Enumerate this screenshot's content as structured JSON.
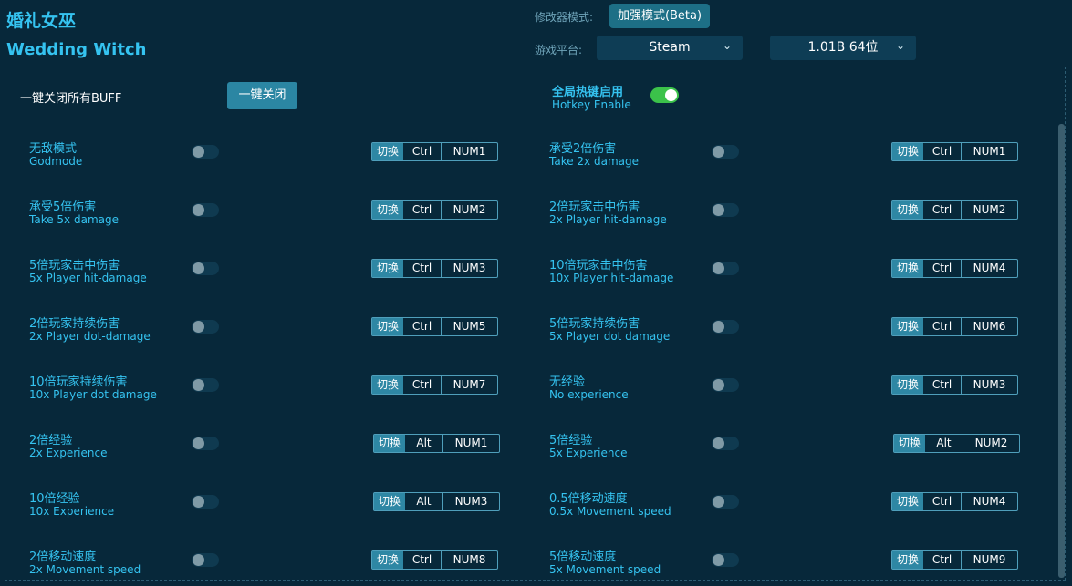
{
  "app": {
    "title_cn": "婚礼女巫",
    "title_en": "Wedding Witch"
  },
  "header": {
    "mode_label": "修改器模式:",
    "mode_button": "加强模式(Beta)",
    "platform_label": "游戏平台:",
    "platform_value": "Steam",
    "version_value": "1.01B 64位"
  },
  "controls": {
    "close_all_label": "一键关闭所有BUFF",
    "close_all_button": "一键关闭",
    "hotkey_cn": "全局热键启用",
    "hotkey_en": "Hotkey Enable",
    "hotkey_enabled": true
  },
  "cheats": [
    {
      "cn": "无敌模式",
      "en": "Godmode",
      "k1": "切换",
      "k2": "Ctrl",
      "k3": "NUM1"
    },
    {
      "cn": "承受2倍伤害",
      "en": "Take 2x damage",
      "k1": "切换",
      "k2": "Ctrl",
      "k3": "NUM1"
    },
    {
      "cn": "承受5倍伤害",
      "en": "Take 5x damage",
      "k1": "切换",
      "k2": "Ctrl",
      "k3": "NUM2"
    },
    {
      "cn": "2倍玩家击中伤害",
      "en": "2x Player hit-damage",
      "k1": "切换",
      "k2": "Ctrl",
      "k3": "NUM2"
    },
    {
      "cn": "5倍玩家击中伤害",
      "en": "5x Player hit-damage",
      "k1": "切换",
      "k2": "Ctrl",
      "k3": "NUM3"
    },
    {
      "cn": "10倍玩家击中伤害",
      "en": "10x Player hit-damage",
      "k1": "切换",
      "k2": "Ctrl",
      "k3": "NUM4"
    },
    {
      "cn": "2倍玩家持续伤害",
      "en": "2x Player dot-damage",
      "k1": "切换",
      "k2": "Ctrl",
      "k3": "NUM5"
    },
    {
      "cn": "5倍玩家持续伤害",
      "en": "5x Player dot damage",
      "k1": "切换",
      "k2": "Ctrl",
      "k3": "NUM6"
    },
    {
      "cn": "10倍玩家持续伤害",
      "en": "10x Player dot damage",
      "k1": "切换",
      "k2": "Ctrl",
      "k3": "NUM7"
    },
    {
      "cn": "无经验",
      "en": "No experience",
      "k1": "切换",
      "k2": "Ctrl",
      "k3": "NUM3"
    },
    {
      "cn": "2倍经验",
      "en": "2x Experience",
      "k1": "切换",
      "k2": "Alt",
      "k3": "NUM1"
    },
    {
      "cn": "5倍经验",
      "en": "5x Experience",
      "k1": "切换",
      "k2": "Alt",
      "k3": "NUM2"
    },
    {
      "cn": "10倍经验",
      "en": "10x Experience",
      "k1": "切换",
      "k2": "Alt",
      "k3": "NUM3"
    },
    {
      "cn": "0.5倍移动速度",
      "en": "0.5x Movement speed",
      "k1": "切换",
      "k2": "Ctrl",
      "k3": "NUM4"
    },
    {
      "cn": "2倍移动速度",
      "en": "2x Movement speed",
      "k1": "切换",
      "k2": "Ctrl",
      "k3": "NUM8"
    },
    {
      "cn": "5倍移动速度",
      "en": "5x Movement speed",
      "k1": "切换",
      "k2": "Ctrl",
      "k3": "NUM9"
    }
  ]
}
